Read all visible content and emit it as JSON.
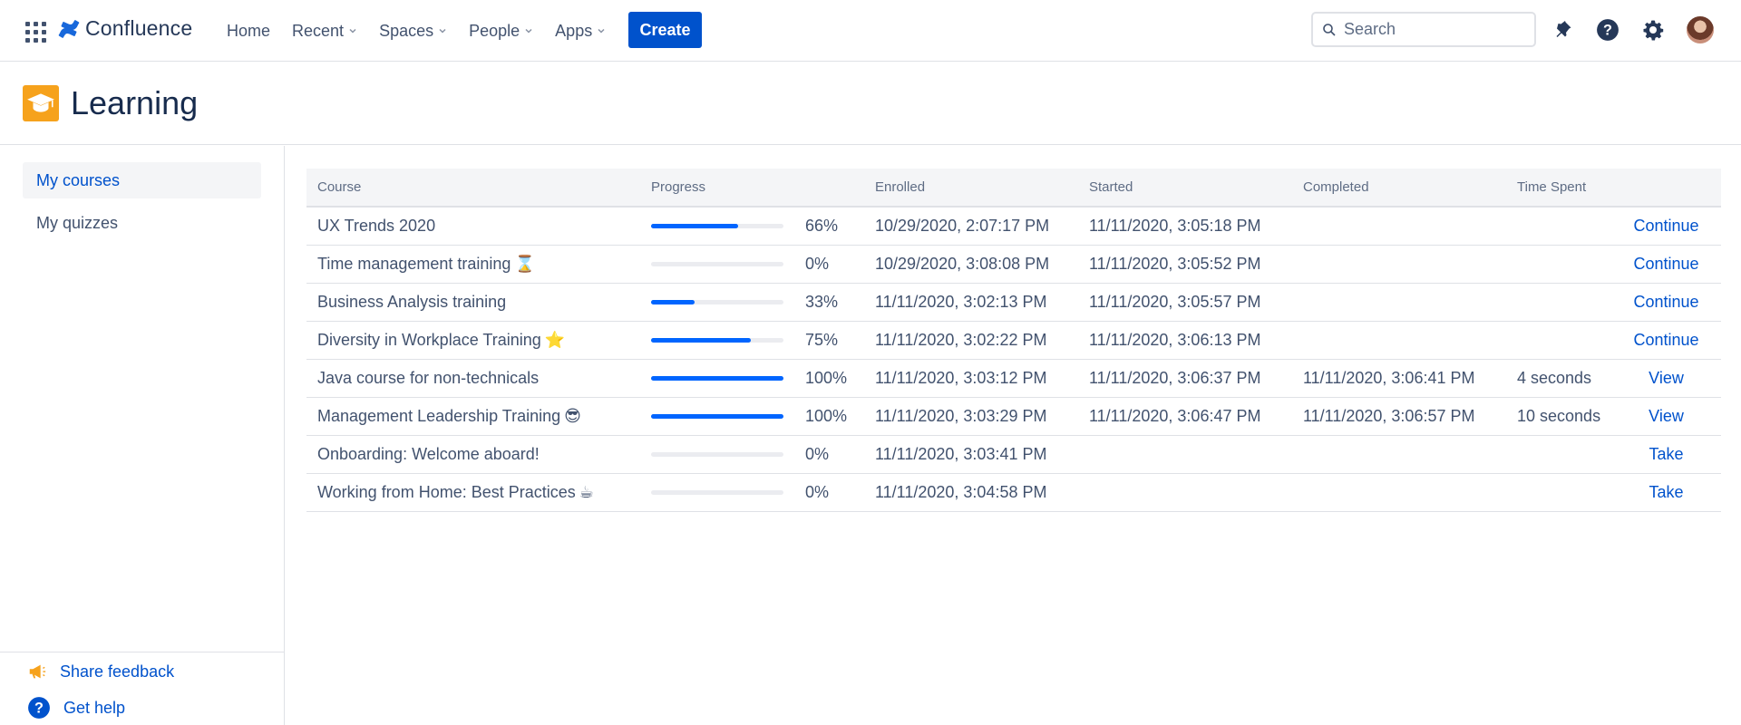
{
  "nav": {
    "logo_text": "Confluence",
    "items": [
      {
        "label": "Home",
        "dropdown": false
      },
      {
        "label": "Recent",
        "dropdown": true
      },
      {
        "label": "Spaces",
        "dropdown": true
      },
      {
        "label": "People",
        "dropdown": true
      },
      {
        "label": "Apps",
        "dropdown": true
      }
    ],
    "create_label": "Create",
    "search_placeholder": "Search"
  },
  "space": {
    "title": "Learning"
  },
  "sidebar": {
    "items": [
      {
        "label": "My courses",
        "active": true
      },
      {
        "label": "My quizzes",
        "active": false
      }
    ],
    "footer": {
      "feedback_label": "Share feedback",
      "help_label": "Get help"
    }
  },
  "table": {
    "headers": [
      "Course",
      "Progress",
      "Enrolled",
      "Started",
      "Completed",
      "Time Spent"
    ],
    "rows": [
      {
        "course": "UX Trends 2020",
        "emoji": "",
        "progress": 66,
        "progress_label": "66%",
        "enrolled": "10/29/2020, 2:07:17 PM",
        "started": "11/11/2020, 3:05:18 PM",
        "completed": "",
        "time_spent": "",
        "action": "Continue"
      },
      {
        "course": "Time management training",
        "emoji": "⌛",
        "progress": 0,
        "progress_label": "0%",
        "enrolled": "10/29/2020, 3:08:08 PM",
        "started": "11/11/2020, 3:05:52 PM",
        "completed": "",
        "time_spent": "",
        "action": "Continue"
      },
      {
        "course": "Business Analysis training",
        "emoji": "",
        "progress": 33,
        "progress_label": "33%",
        "enrolled": "11/11/2020, 3:02:13 PM",
        "started": "11/11/2020, 3:05:57 PM",
        "completed": "",
        "time_spent": "",
        "action": "Continue"
      },
      {
        "course": "Diversity in Workplace Training",
        "emoji": "⭐",
        "progress": 75,
        "progress_label": "75%",
        "enrolled": "11/11/2020, 3:02:22 PM",
        "started": "11/11/2020, 3:06:13 PM",
        "completed": "",
        "time_spent": "",
        "action": "Continue"
      },
      {
        "course": "Java course for non-technicals",
        "emoji": "",
        "progress": 100,
        "progress_label": "100%",
        "enrolled": "11/11/2020, 3:03:12 PM",
        "started": "11/11/2020, 3:06:37 PM",
        "completed": "11/11/2020, 3:06:41 PM",
        "time_spent": "4 seconds",
        "action": "View"
      },
      {
        "course": "Management Leadership Training",
        "emoji": "😎",
        "progress": 100,
        "progress_label": "100%",
        "enrolled": "11/11/2020, 3:03:29 PM",
        "started": "11/11/2020, 3:06:47 PM",
        "completed": "11/11/2020, 3:06:57 PM",
        "time_spent": "10 seconds",
        "action": "View"
      },
      {
        "course": "Onboarding: Welcome aboard!",
        "emoji": "",
        "progress": 0,
        "progress_label": "0%",
        "enrolled": "11/11/2020, 3:03:41 PM",
        "started": "",
        "completed": "",
        "time_spent": "",
        "action": "Take"
      },
      {
        "course": "Working from Home: Best Practices",
        "emoji": "☕",
        "progress": 0,
        "progress_label": "0%",
        "enrolled": "11/11/2020, 3:04:58 PM",
        "started": "",
        "completed": "",
        "time_spent": "",
        "action": "Take"
      }
    ]
  },
  "colors": {
    "primary": "#0052cc",
    "progress_fill": "#0065ff",
    "progress_track": "#ebecf0",
    "space_icon": "#f6a21c"
  },
  "icons": {
    "app_switcher": "app-switcher-icon",
    "logo": "confluence-logo-icon",
    "search": "search-icon",
    "notifications": "notification-icon",
    "help": "help-icon",
    "settings": "gear-icon",
    "space": "graduation-cap-icon",
    "feedback": "megaphone-icon",
    "get_help": "help-icon"
  }
}
